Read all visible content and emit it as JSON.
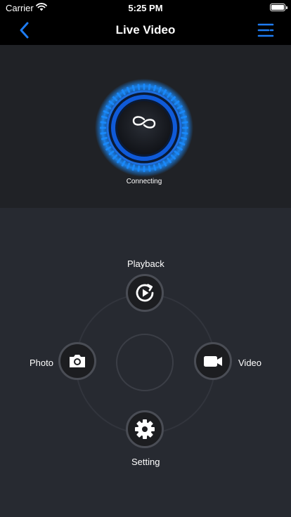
{
  "status_bar": {
    "carrier": "Carrier",
    "time": "5:25 PM"
  },
  "nav": {
    "title": "Live Video",
    "back_icon": "chevron-left-icon",
    "menu_icon": "menu-lines-icon",
    "accent_color": "#1e7cf2"
  },
  "video": {
    "status_text": "Connecting",
    "status_icon": "link-icon",
    "glow_color": "#1a8cff"
  },
  "controls": {
    "playback_label": "Playback",
    "photo_label": "Photo",
    "video_label": "Video",
    "setting_label": "Setting"
  }
}
